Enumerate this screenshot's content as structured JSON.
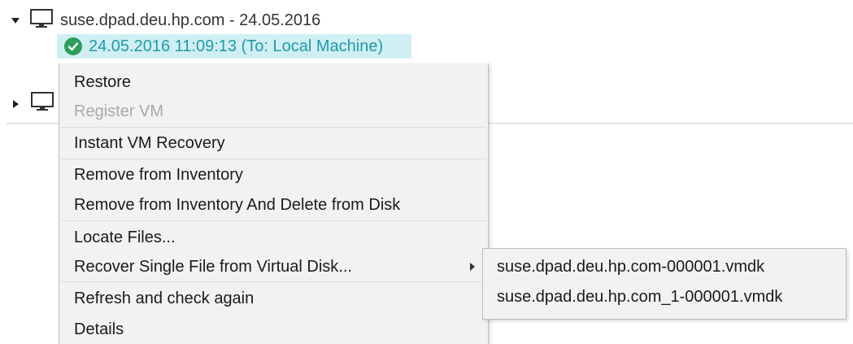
{
  "tree": {
    "host1": {
      "label": "suse.dpad.deu.hp.com - 24.05.2016",
      "expanded": true
    },
    "selected_item": {
      "label": "24.05.2016 11:09:13 (To: Local Machine)",
      "status": "success"
    },
    "host2": {
      "expanded": false
    }
  },
  "context_menu": {
    "items": [
      {
        "label": "Restore",
        "enabled": true
      },
      {
        "label": "Register VM",
        "enabled": false
      },
      {
        "label": "Instant VM Recovery",
        "enabled": true
      },
      {
        "label": "Remove from Inventory",
        "enabled": true
      },
      {
        "label": "Remove from Inventory And Delete from Disk",
        "enabled": true
      },
      {
        "label": "Locate Files...",
        "enabled": true
      },
      {
        "label": "Recover Single File from Virtual Disk...",
        "enabled": true,
        "has_submenu": true
      },
      {
        "label": "Refresh and check again",
        "enabled": true
      },
      {
        "label": "Details",
        "enabled": true
      }
    ]
  },
  "submenu": {
    "items": [
      {
        "label": "suse.dpad.deu.hp.com-000001.vmdk"
      },
      {
        "label": "suse.dpad.deu.hp.com_1-000001.vmdk"
      }
    ]
  },
  "colors": {
    "selection_bg": "#cfeff5",
    "selection_text": "#1f9aa8",
    "success": "#2e9e5a",
    "disabled_text": "#a9a9a9",
    "menu_bg": "#f2f2f2"
  }
}
